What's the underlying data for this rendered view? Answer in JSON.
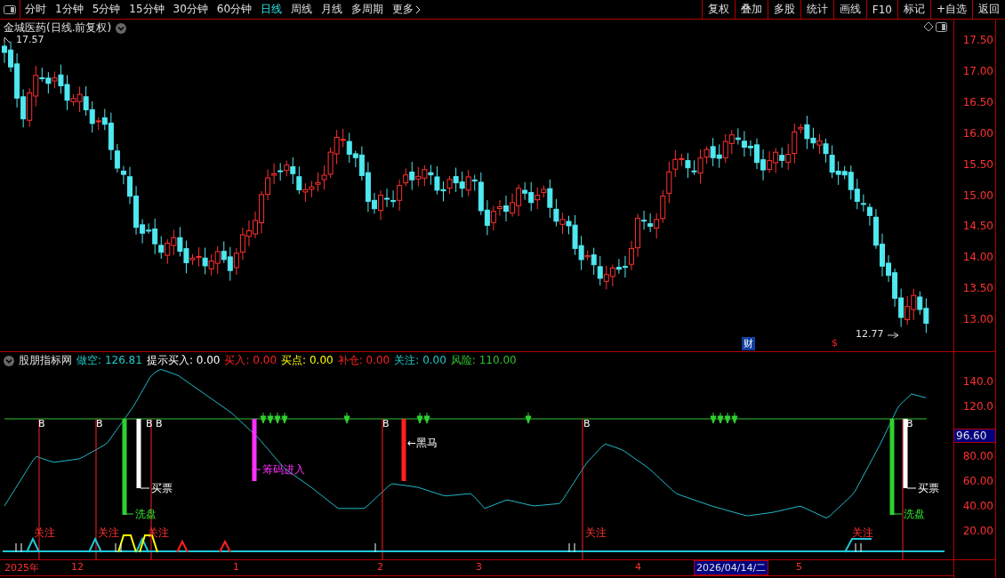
{
  "toolbar": {
    "periods": [
      {
        "label": "分时",
        "selected": false
      },
      {
        "label": "1分钟",
        "selected": false
      },
      {
        "label": "5分钟",
        "selected": false
      },
      {
        "label": "15分钟",
        "selected": false
      },
      {
        "label": "30分钟",
        "selected": false
      },
      {
        "label": "60分钟",
        "selected": false
      },
      {
        "label": "日线",
        "selected": true
      },
      {
        "label": "周线",
        "selected": false
      },
      {
        "label": "月线",
        "selected": false
      },
      {
        "label": "多周期",
        "selected": false
      },
      {
        "label": "更多",
        "selected": false
      }
    ],
    "buttons": [
      "复权",
      "叠加",
      "多股",
      "统计",
      "画线",
      "F10",
      "标记",
      "+自选",
      "返回"
    ]
  },
  "price_panel": {
    "title": "金城医药(日线.前复权)",
    "high_label": "17.57",
    "low_label": "12.77",
    "markers": [
      "财",
      "$"
    ],
    "axis_ticks": [
      "17.50",
      "17.00",
      "16.50",
      "16.00",
      "15.50",
      "15.00",
      "14.50",
      "14.00",
      "13.50",
      "13.00"
    ]
  },
  "indicator": {
    "name": "股朋指标网",
    "values": [
      {
        "label": "做空:",
        "value": "126.81",
        "color": "#20c8c8"
      },
      {
        "label": "提示买入:",
        "value": "0.00",
        "color": "#ffffff"
      },
      {
        "label": "买入:",
        "value": "0.00",
        "color": "#ff2020"
      },
      {
        "label": "买点:",
        "value": "0.00",
        "color": "#ffff00"
      },
      {
        "label": "补仓:",
        "value": "0.00",
        "color": "#ff2020"
      },
      {
        "label": "关注:",
        "value": "0.00",
        "color": "#20c8c8"
      },
      {
        "label": "风险:",
        "value": "110.00",
        "color": "#30c030"
      }
    ],
    "b_marks": [
      "B",
      "B",
      "B",
      "B",
      "B",
      "B",
      "B"
    ],
    "labels": [
      {
        "text": "买票",
        "kind": "buy"
      },
      {
        "text": "洗盘",
        "kind": "wash"
      },
      {
        "text": "筹码进入",
        "kind": "chips"
      },
      {
        "text": "←黑马",
        "kind": "horse"
      },
      {
        "text": "买票",
        "kind": "buy"
      },
      {
        "text": "洗盘",
        "kind": "wash"
      }
    ],
    "watch_labels": [
      "关注",
      "关注",
      "关注",
      "关注",
      "关注"
    ],
    "axis_ticks": [
      "140.0",
      "120.0",
      "80.00",
      "60.00",
      "40.00",
      "20.00"
    ],
    "cursor_value": "96.60"
  },
  "date_axis": {
    "labels": [
      "2025年",
      "12",
      "1",
      "2",
      "3",
      "4",
      "5"
    ],
    "cursor_date": "2026/04/14/二"
  }
}
